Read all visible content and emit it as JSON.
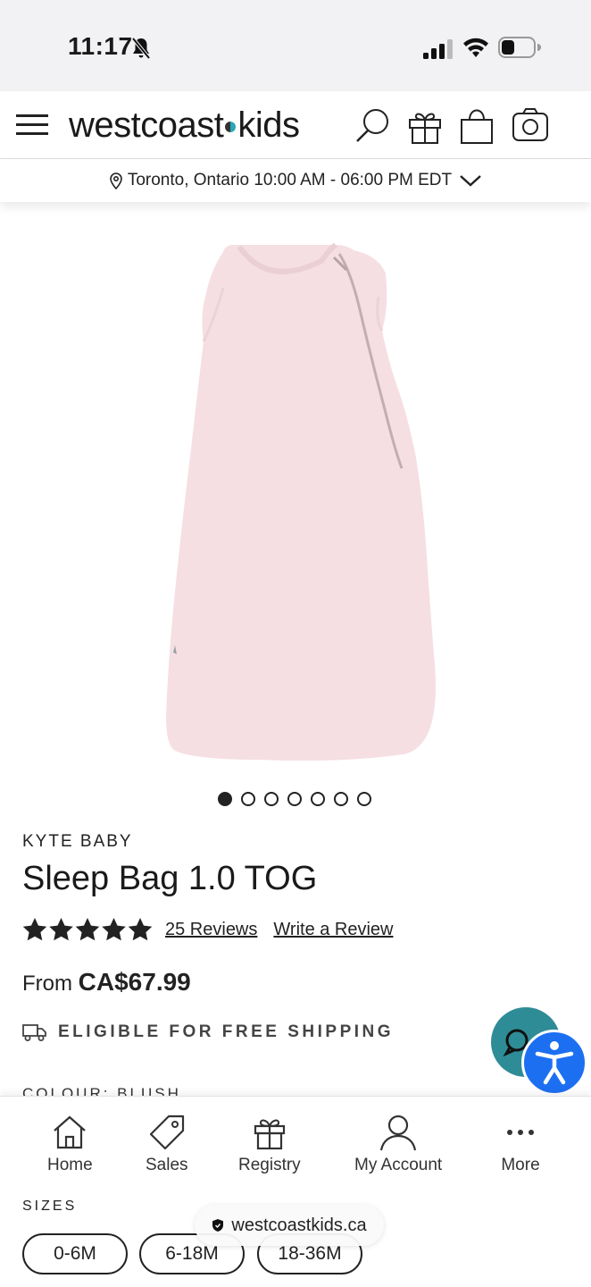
{
  "status_bar": {
    "time": "11:17"
  },
  "header": {
    "logo_left": "westcoast",
    "logo_right": "kids"
  },
  "location": {
    "text": "Toronto, Ontario 10:00 AM - 06:00 PM EDT"
  },
  "gallery": {
    "image_count": 7,
    "active_index": 0
  },
  "product": {
    "brand": "KYTE BABY",
    "title": "Sleep Bag 1.0 TOG",
    "rating": 5,
    "reviews_link": "25 Reviews",
    "write_review_link": "Write a Review",
    "price_prefix": "From",
    "price": "CA$67.99",
    "shipping": "ELIGIBLE FOR FREE SHIPPING",
    "colour_label": "COLOUR: BLUSH",
    "image_color": "#f5dfe3"
  },
  "bottom_nav": {
    "items": [
      {
        "label": "Home",
        "icon": "home-icon"
      },
      {
        "label": "Sales",
        "icon": "tag-icon"
      },
      {
        "label": "Registry",
        "icon": "gift-icon"
      },
      {
        "label": "My Account",
        "icon": "user-icon"
      },
      {
        "label": "More",
        "icon": "more-dots-icon"
      }
    ]
  },
  "sizes": {
    "label": "SIZES",
    "options": [
      "0-6M",
      "6-18M",
      "18-36M"
    ]
  },
  "browser": {
    "url": "westcoastkids.ca"
  },
  "colors": {
    "chat": "#2e8c96",
    "accessibility": "#1d6ff2",
    "logo_dot": "#2aa6b5"
  }
}
